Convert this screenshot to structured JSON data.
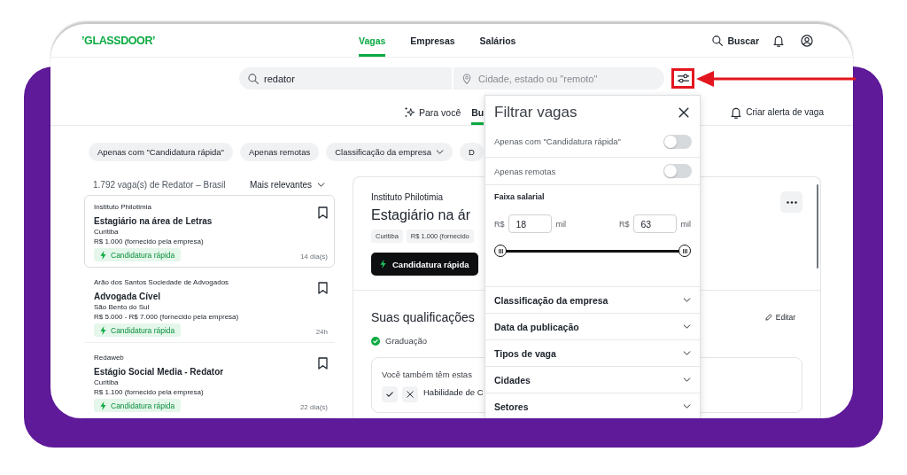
{
  "header": {
    "logo": "’GLASSDOOR’",
    "nav": [
      {
        "label": "Vagas",
        "selected": true
      },
      {
        "label": "Empresas",
        "selected": false
      },
      {
        "label": "Salários",
        "selected": false
      }
    ],
    "search_label": "Buscar"
  },
  "search": {
    "keyword": {
      "value": "redator"
    },
    "location": {
      "placeholder": "Cidade, estado ou \"remoto\""
    }
  },
  "annotation": {
    "highlight_box": true,
    "arrow": true
  },
  "tabs": [
    {
      "label": "Para você",
      "kind": "sparkle",
      "selected": false
    },
    {
      "label": "Bu",
      "kind": "plain",
      "selected": true
    }
  ],
  "alert_button": "Criar alerta de vaga",
  "chips": [
    {
      "label": "Apenas com \"Candidatura rápida\"",
      "kind": "plain"
    },
    {
      "label": "Apenas remotas",
      "kind": "plain"
    },
    {
      "label": "Classificação da empresa",
      "kind": "dropdown"
    },
    {
      "label": "D",
      "kind": "plain"
    }
  ],
  "results": {
    "summary": "1.792 vaga(s) de Redator – Brasil",
    "sort": "Mais relevantes",
    "jobs": [
      {
        "company": "Instituto Philotimia",
        "title": "Estagiário na área de Letras",
        "location": "Curitiba",
        "salary": "R$ 1.000 (fornecido pela empresa)",
        "badge": "Candidatura rápida",
        "age": "14 dia(s)",
        "selected": true
      },
      {
        "company": "Arão dos Santos Sociedade de Advogados",
        "title": "Advogada Cível",
        "location": "São Bento do Sul",
        "salary": "R$ 5.000 - R$ 7.000 (fornecido pela empresa)",
        "badge": "Candidatura rápida",
        "age": "24h",
        "selected": false
      },
      {
        "company": "Redaweb",
        "title": "Estágio Social Media - Redator",
        "location": "Curitiba",
        "salary": "R$ 1.100 (fornecido pela empresa)",
        "badge": "Candidatura rápida",
        "age": "22 dia(s)",
        "selected": false
      }
    ]
  },
  "detail": {
    "company": "Instituto Philotimia",
    "title": "Estagiário na ár",
    "tags": [
      "Curitiba",
      "R$ 1.000 (fornecido"
    ],
    "apply_button": "Candidatura rápida",
    "qualifications": {
      "title": "Suas qualificações",
      "edit_label": "Editar",
      "items": [
        {
          "label": "Graduação",
          "matched": true
        }
      ],
      "prompt": "Você também têm estas",
      "skills": [
        {
          "label": "Habilidade de C"
        }
      ]
    }
  },
  "filter_panel": {
    "title": "Filtrar vagas",
    "toggles": [
      {
        "label": "Apenas com \"Candidatura rápida\"",
        "on": false
      },
      {
        "label": "Apenas remotas",
        "on": false
      }
    ],
    "salary": {
      "title": "Faixa salarial",
      "fields": [
        {
          "prefix": "R$",
          "value": "18",
          "suffix": "mil"
        },
        {
          "prefix": "R$",
          "value": "63",
          "suffix": "mil"
        }
      ],
      "thumbs": [
        {
          "level": 0
        },
        {
          "level": 1
        }
      ]
    },
    "sections": [
      {
        "label": "Classificação da empresa",
        "expanded": false
      },
      {
        "label": "Data da publicação",
        "expanded": false
      },
      {
        "label": "Tipos de vaga",
        "expanded": false
      },
      {
        "label": "Cidades",
        "expanded": false
      },
      {
        "label": "Setores",
        "expanded": false
      }
    ]
  }
}
